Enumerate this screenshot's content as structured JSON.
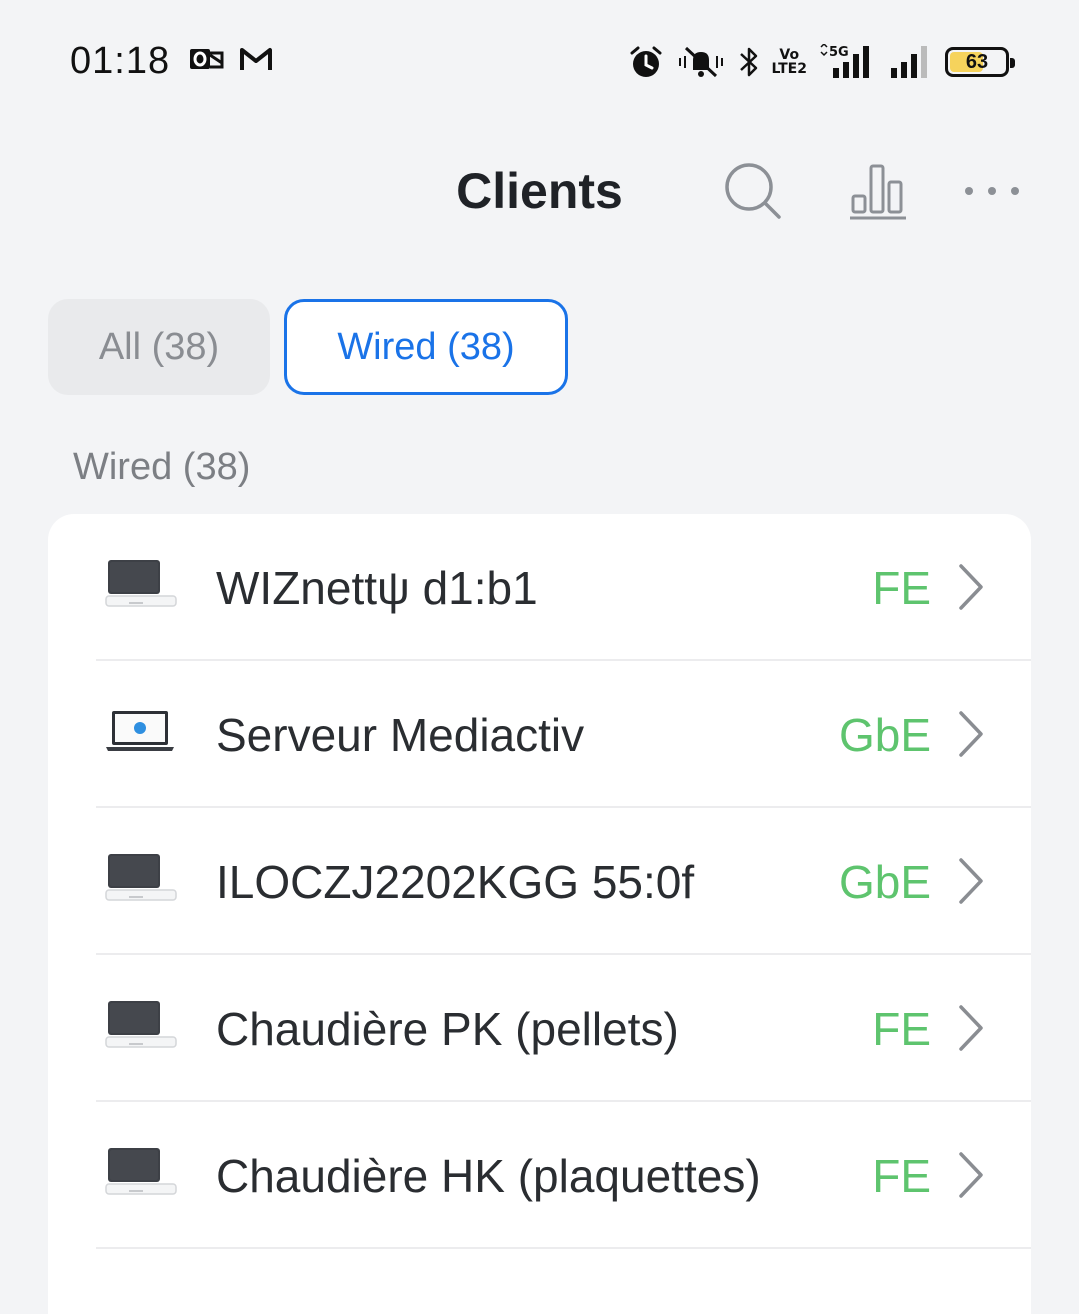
{
  "status_bar": {
    "time": "01:18",
    "left_icons": [
      "outlook-icon",
      "gmail-icon"
    ],
    "right_icons": [
      "alarm-icon",
      "vibrate-mute-icon",
      "bluetooth-icon",
      "volte-icon",
      "5g-signal-icon",
      "signal-icon",
      "battery-icon"
    ],
    "volte_top": "Vo",
    "volte_bottom": "LTE2",
    "network": "5G",
    "battery": "63",
    "battery_level_percent": 63,
    "battery_color": "#f6d35c"
  },
  "header": {
    "title": "Clients",
    "actions": [
      "search-icon",
      "bar-chart-icon",
      "more-icon"
    ]
  },
  "filters": {
    "all_label": "All (38)",
    "wired_label": "Wired (38)",
    "active": "wired"
  },
  "section": {
    "label": "Wired (38)"
  },
  "clients": [
    {
      "name": "WIZnettψ d1:b1",
      "speed": "FE",
      "icon": "device-monitor-icon"
    },
    {
      "name": "Serveur Mediactiv",
      "speed": "GbE",
      "icon": "hp-laptop-icon"
    },
    {
      "name": "ILOCZJ2202KGG 55:0f",
      "speed": "GbE",
      "icon": "device-monitor-icon"
    },
    {
      "name": "Chaudière PK (pellets)",
      "speed": "FE",
      "icon": "device-monitor-icon"
    },
    {
      "name": "Chaudière HK (plaquettes)",
      "speed": "FE",
      "icon": "device-monitor-icon"
    }
  ],
  "colors": {
    "accent": "#1a73e8",
    "speed": "#5ec46e",
    "background": "#f3f4f6"
  }
}
